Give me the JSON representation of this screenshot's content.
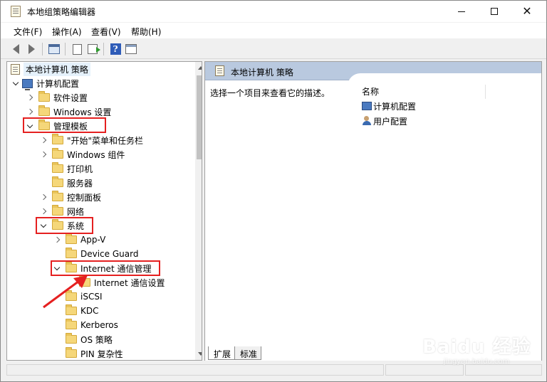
{
  "window": {
    "title": "本地组策略编辑器",
    "minimize_glyph": "",
    "close_glyph": "✕"
  },
  "menu": {
    "items": [
      "文件(F)",
      "操作(A)",
      "查看(V)",
      "帮助(H)"
    ]
  },
  "toolbar": {
    "help_glyph": "?"
  },
  "tree": {
    "root": "本地计算机 策略",
    "computer_config": "计算机配置",
    "software_settings": "软件设置",
    "windows_settings": "Windows 设置",
    "admin_templates": "管理模板",
    "start_menu": "\"开始\"菜单和任务栏",
    "windows_components": "Windows 组件",
    "printers": "打印机",
    "servers": "服务器",
    "control_panel": "控制面板",
    "network": "网络",
    "system": "系统",
    "app_v": "App-V",
    "device_guard": "Device Guard",
    "internet_comm_mgmt": "Internet 通信管理",
    "internet_comm_settings": "Internet 通信设置",
    "iscsi": "iSCSI",
    "kdc": "KDC",
    "kerberos": "Kerberos",
    "os_policy": "OS 策略",
    "pin_complexity": "PIN 复杂性"
  },
  "right_pane": {
    "header": "本地计算机 策略",
    "description": "选择一个项目来查看它的描述。",
    "column_name": "名称",
    "items": [
      "计算机配置",
      "用户配置"
    ]
  },
  "tabs": {
    "expand": "扩展",
    "standard": "标准"
  },
  "watermark": {
    "main": "Baidu 经验",
    "sub": "jingyan.baidu.com"
  },
  "colors": {
    "highlight": "#e52020",
    "header_bg": "#b9c9df",
    "folder": "#f5d77a"
  }
}
